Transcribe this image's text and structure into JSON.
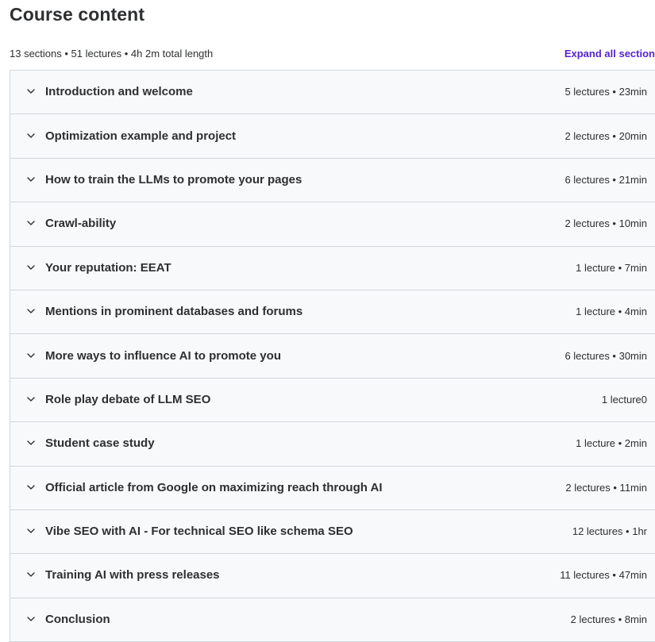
{
  "header": {
    "title": "Course content",
    "summary": "13 sections • 51 lectures • 4h 2m total length",
    "expand_all_label": "Expand all section"
  },
  "icons": {
    "section_toggle": "chevron-down-icon"
  },
  "colors": {
    "accent": "#5624d0",
    "section_bg": "#f7f9fa",
    "border": "#d1d7dc",
    "text": "#2d2f31"
  },
  "sections": [
    {
      "title": "Introduction and welcome",
      "meta": "5 lectures • 23min"
    },
    {
      "title": "Optimization example and project",
      "meta": "2 lectures • 20min"
    },
    {
      "title": "How to train the LLMs to promote your pages",
      "meta": "6 lectures • 21min"
    },
    {
      "title": "Crawl-ability",
      "meta": "2 lectures • 10min"
    },
    {
      "title": "Your reputation: EEAT",
      "meta": "1 lecture • 7min"
    },
    {
      "title": "Mentions in prominent databases and forums",
      "meta": "1 lecture • 4min"
    },
    {
      "title": "More ways to influence AI to promote you",
      "meta": "6 lectures • 30min"
    },
    {
      "title": "Role play debate of LLM SEO",
      "meta": "1 lecture0"
    },
    {
      "title": "Student case study",
      "meta": "1 lecture • 2min"
    },
    {
      "title": "Official article from Google on maximizing reach through AI",
      "meta": "2 lectures • 11min"
    },
    {
      "title": "Vibe SEO with AI - For technical SEO like schema SEO",
      "meta": "12 lectures • 1hr"
    },
    {
      "title": "Training AI with press releases",
      "meta": "11 lectures • 47min"
    },
    {
      "title": "Conclusion",
      "meta": "2 lectures • 8min"
    }
  ]
}
